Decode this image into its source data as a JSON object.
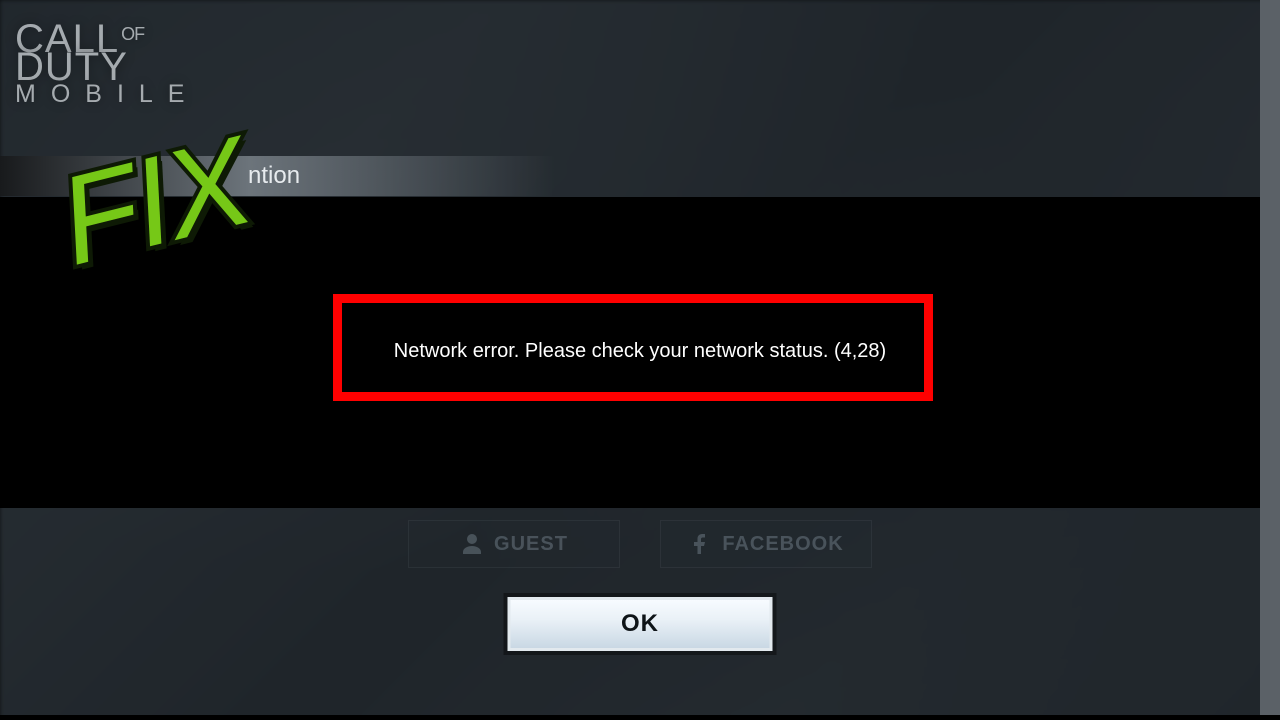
{
  "logo": {
    "line1a": "CALL",
    "line1b": "OF",
    "line1c": "DUTY",
    "line2": "MOBILE"
  },
  "sticker": {
    "text": "FIX"
  },
  "dialog": {
    "title_visible_suffix": "ntion",
    "message": "Network error. Please check your network status. (4,28)",
    "ok_label": "OK"
  },
  "login": {
    "guest_label": "GUEST",
    "facebook_label": "FACEBOOK"
  }
}
